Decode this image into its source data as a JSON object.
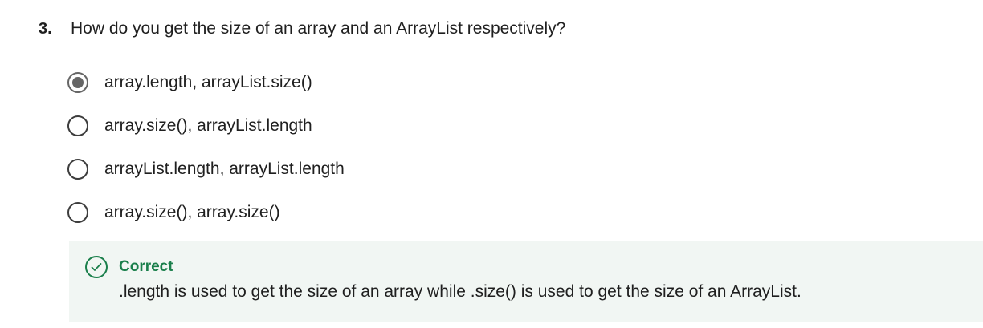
{
  "question": {
    "number": "3.",
    "text": "How do you get the size of an array and an ArrayList respectively?"
  },
  "options": [
    {
      "label": "array.length, arrayList.size()",
      "selected": true
    },
    {
      "label": "array.size(), arrayList.length",
      "selected": false
    },
    {
      "label": "arrayList.length, arrayList.length",
      "selected": false
    },
    {
      "label": "array.size(), array.size()",
      "selected": false
    }
  ],
  "feedback": {
    "status": "Correct",
    "explanation": ".length is used to get the size of an array while .size() is used to get the size of an ArrayList.",
    "icon": "check-circle-icon",
    "color": "#1a7f4b"
  }
}
